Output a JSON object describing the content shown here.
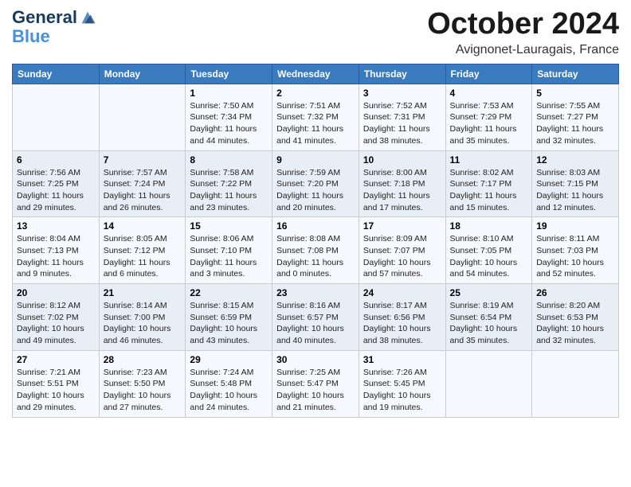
{
  "header": {
    "logo_line1": "General",
    "logo_line2": "Blue",
    "month": "October 2024",
    "location": "Avignonet-Lauragais, France"
  },
  "weekdays": [
    "Sunday",
    "Monday",
    "Tuesday",
    "Wednesday",
    "Thursday",
    "Friday",
    "Saturday"
  ],
  "rows": [
    [
      {
        "day": "",
        "info": ""
      },
      {
        "day": "",
        "info": ""
      },
      {
        "day": "1",
        "info": "Sunrise: 7:50 AM\nSunset: 7:34 PM\nDaylight: 11 hours and 44 minutes."
      },
      {
        "day": "2",
        "info": "Sunrise: 7:51 AM\nSunset: 7:32 PM\nDaylight: 11 hours and 41 minutes."
      },
      {
        "day": "3",
        "info": "Sunrise: 7:52 AM\nSunset: 7:31 PM\nDaylight: 11 hours and 38 minutes."
      },
      {
        "day": "4",
        "info": "Sunrise: 7:53 AM\nSunset: 7:29 PM\nDaylight: 11 hours and 35 minutes."
      },
      {
        "day": "5",
        "info": "Sunrise: 7:55 AM\nSunset: 7:27 PM\nDaylight: 11 hours and 32 minutes."
      }
    ],
    [
      {
        "day": "6",
        "info": "Sunrise: 7:56 AM\nSunset: 7:25 PM\nDaylight: 11 hours and 29 minutes."
      },
      {
        "day": "7",
        "info": "Sunrise: 7:57 AM\nSunset: 7:24 PM\nDaylight: 11 hours and 26 minutes."
      },
      {
        "day": "8",
        "info": "Sunrise: 7:58 AM\nSunset: 7:22 PM\nDaylight: 11 hours and 23 minutes."
      },
      {
        "day": "9",
        "info": "Sunrise: 7:59 AM\nSunset: 7:20 PM\nDaylight: 11 hours and 20 minutes."
      },
      {
        "day": "10",
        "info": "Sunrise: 8:00 AM\nSunset: 7:18 PM\nDaylight: 11 hours and 17 minutes."
      },
      {
        "day": "11",
        "info": "Sunrise: 8:02 AM\nSunset: 7:17 PM\nDaylight: 11 hours and 15 minutes."
      },
      {
        "day": "12",
        "info": "Sunrise: 8:03 AM\nSunset: 7:15 PM\nDaylight: 11 hours and 12 minutes."
      }
    ],
    [
      {
        "day": "13",
        "info": "Sunrise: 8:04 AM\nSunset: 7:13 PM\nDaylight: 11 hours and 9 minutes."
      },
      {
        "day": "14",
        "info": "Sunrise: 8:05 AM\nSunset: 7:12 PM\nDaylight: 11 hours and 6 minutes."
      },
      {
        "day": "15",
        "info": "Sunrise: 8:06 AM\nSunset: 7:10 PM\nDaylight: 11 hours and 3 minutes."
      },
      {
        "day": "16",
        "info": "Sunrise: 8:08 AM\nSunset: 7:08 PM\nDaylight: 11 hours and 0 minutes."
      },
      {
        "day": "17",
        "info": "Sunrise: 8:09 AM\nSunset: 7:07 PM\nDaylight: 10 hours and 57 minutes."
      },
      {
        "day": "18",
        "info": "Sunrise: 8:10 AM\nSunset: 7:05 PM\nDaylight: 10 hours and 54 minutes."
      },
      {
        "day": "19",
        "info": "Sunrise: 8:11 AM\nSunset: 7:03 PM\nDaylight: 10 hours and 52 minutes."
      }
    ],
    [
      {
        "day": "20",
        "info": "Sunrise: 8:12 AM\nSunset: 7:02 PM\nDaylight: 10 hours and 49 minutes."
      },
      {
        "day": "21",
        "info": "Sunrise: 8:14 AM\nSunset: 7:00 PM\nDaylight: 10 hours and 46 minutes."
      },
      {
        "day": "22",
        "info": "Sunrise: 8:15 AM\nSunset: 6:59 PM\nDaylight: 10 hours and 43 minutes."
      },
      {
        "day": "23",
        "info": "Sunrise: 8:16 AM\nSunset: 6:57 PM\nDaylight: 10 hours and 40 minutes."
      },
      {
        "day": "24",
        "info": "Sunrise: 8:17 AM\nSunset: 6:56 PM\nDaylight: 10 hours and 38 minutes."
      },
      {
        "day": "25",
        "info": "Sunrise: 8:19 AM\nSunset: 6:54 PM\nDaylight: 10 hours and 35 minutes."
      },
      {
        "day": "26",
        "info": "Sunrise: 8:20 AM\nSunset: 6:53 PM\nDaylight: 10 hours and 32 minutes."
      }
    ],
    [
      {
        "day": "27",
        "info": "Sunrise: 7:21 AM\nSunset: 5:51 PM\nDaylight: 10 hours and 29 minutes."
      },
      {
        "day": "28",
        "info": "Sunrise: 7:23 AM\nSunset: 5:50 PM\nDaylight: 10 hours and 27 minutes."
      },
      {
        "day": "29",
        "info": "Sunrise: 7:24 AM\nSunset: 5:48 PM\nDaylight: 10 hours and 24 minutes."
      },
      {
        "day": "30",
        "info": "Sunrise: 7:25 AM\nSunset: 5:47 PM\nDaylight: 10 hours and 21 minutes."
      },
      {
        "day": "31",
        "info": "Sunrise: 7:26 AM\nSunset: 5:45 PM\nDaylight: 10 hours and 19 minutes."
      },
      {
        "day": "",
        "info": ""
      },
      {
        "day": "",
        "info": ""
      }
    ]
  ]
}
